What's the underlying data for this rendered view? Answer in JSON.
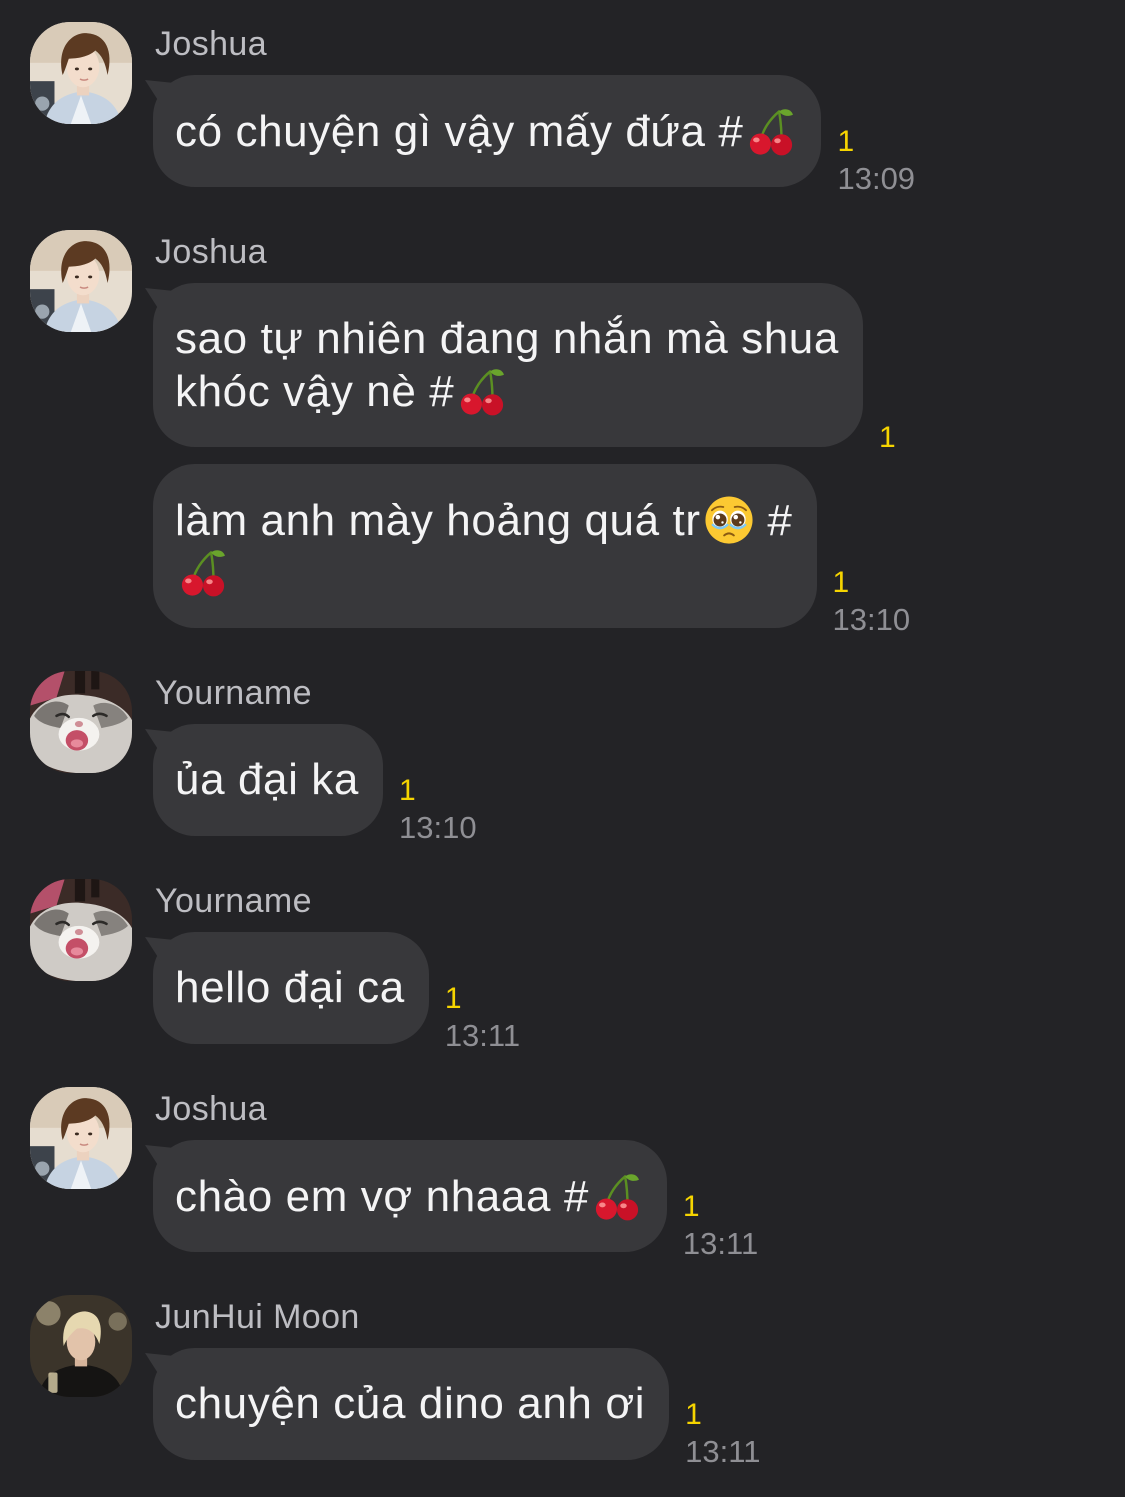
{
  "colors": {
    "background": "#232326",
    "bubble": "#38383b",
    "text": "#f4f4f5",
    "sender": "#bdbdc2",
    "read_count": "#f5d400",
    "time": "#8f8f94"
  },
  "groups": [
    {
      "sender": "Joshua",
      "avatar": "joshua-profile-photo",
      "messages": [
        {
          "lines": [
            [
              {
                "text": "có chuyện gì vậy mấy đứa #"
              },
              {
                "emoji": "cherries"
              }
            ]
          ],
          "read": "1",
          "time": "13:09"
        }
      ]
    },
    {
      "sender": "Joshua",
      "avatar": "joshua-profile-photo",
      "messages": [
        {
          "lines": [
            [
              {
                "text": "sao tự nhiên đang nhắn mà shua"
              }
            ],
            [
              {
                "text": "khóc vậy nè #"
              },
              {
                "emoji": "cherries"
              }
            ]
          ],
          "read": "1"
        },
        {
          "lines": [
            [
              {
                "text": "làm anh mày hoảng quá tr"
              },
              {
                "emoji": "face-holding-back-tears"
              },
              {
                "text": " #"
              }
            ],
            [
              {
                "emoji": "cherries"
              }
            ]
          ],
          "read": "1",
          "time": "13:10"
        }
      ]
    },
    {
      "sender": "Yourname",
      "avatar": "cat-profile-photo",
      "messages": [
        {
          "lines": [
            [
              {
                "text": "ủa đại ka"
              }
            ]
          ],
          "read": "1",
          "time": "13:10"
        }
      ]
    },
    {
      "sender": "Yourname",
      "avatar": "cat-profile-photo",
      "messages": [
        {
          "lines": [
            [
              {
                "text": "hello đại ca"
              }
            ]
          ],
          "read": "1",
          "time": "13:11"
        }
      ]
    },
    {
      "sender": "Joshua",
      "avatar": "joshua-profile-photo",
      "messages": [
        {
          "lines": [
            [
              {
                "text": "chào em vợ nhaaa #"
              },
              {
                "emoji": "cherries"
              }
            ]
          ],
          "read": "1",
          "time": "13:11"
        }
      ]
    },
    {
      "sender": "JunHui Moon",
      "avatar": "junhui-profile-photo",
      "messages": [
        {
          "lines": [
            [
              {
                "text": "chuyện của dino anh ơi"
              }
            ]
          ],
          "read": "1",
          "time": "13:11"
        }
      ]
    }
  ]
}
